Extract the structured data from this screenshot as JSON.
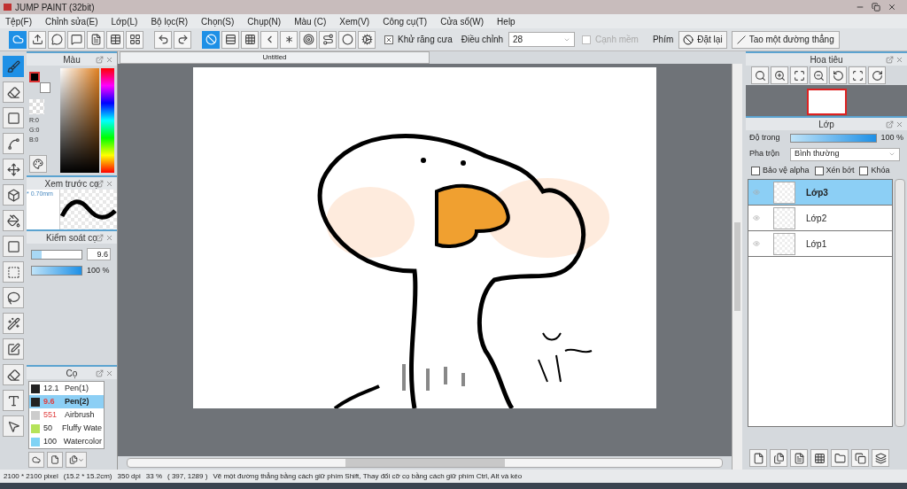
{
  "window": {
    "title": "JUMP PAINT (32bit)"
  },
  "menu": [
    "Tệp(F)",
    "Chỉnh sửa(E)",
    "Lớp(L)",
    "Bộ lọc(R)",
    "Chọn(S)",
    "Chụp(N)",
    "Màu (C)",
    "Xem(V)",
    "Công cụ(T)",
    "Cửa sổ(W)",
    "Help"
  ],
  "toolbar": {
    "rulers": [
      {
        "selected": true
      },
      {
        "selected": false
      },
      {
        "selected": false
      },
      {
        "selected": false
      },
      {
        "selected": false
      },
      {
        "selected": false
      },
      {
        "selected": false
      },
      {
        "selected": false
      },
      {
        "selected": false
      }
    ],
    "antialias": {
      "label": "Khử răng cưa",
      "checked": true
    },
    "adjust": {
      "label": "Điều chỉnh",
      "value": "28"
    },
    "soft_edge": {
      "label": "Cạnh mềm",
      "checked": false,
      "disabled": true
    },
    "keys_label": "Phím",
    "reset_button": "Đặt lại",
    "line_button": "Tao một đường thẳng"
  },
  "tools": [
    {
      "selected": true
    },
    {
      "selected": false
    },
    {
      "selected": false
    },
    {
      "selected": false
    },
    {
      "selected": false
    },
    {
      "selected": false
    },
    {
      "selected": false
    },
    {
      "selected": false
    },
    {
      "selected": false
    },
    {
      "selected": false
    },
    {
      "selected": false
    },
    {
      "selected": false
    },
    {
      "selected": false
    },
    {
      "selected": false
    },
    {
      "selected": false
    }
  ],
  "color_panel": {
    "title": "Màu",
    "rgb": [
      "R:0",
      "G:0",
      "B:0"
    ]
  },
  "brush_preview": {
    "title": "Xem trước cọ",
    "size": "* 0.70mm"
  },
  "brush_control": {
    "title": "Kiểm soát cọ",
    "size": {
      "level": 0.2,
      "reading": "9.6"
    },
    "opacity": {
      "level": 1,
      "reading": "100 %"
    }
  },
  "brushes": {
    "title": "Cọ",
    "items": [
      {
        "size": "12.1",
        "name": "Pen(1)",
        "color": "#222222",
        "flagged": false,
        "selected": false
      },
      {
        "size": "9.6",
        "name": "Pen(2)",
        "color": "#222222",
        "flagged": true,
        "selected": true
      },
      {
        "size": "551",
        "name": "Airbrush",
        "color": "#cccccc",
        "flagged": true,
        "selected": false
      },
      {
        "size": "50",
        "name": "Fluffy Wate",
        "color": "#b5e35a",
        "flagged": false,
        "selected": false
      },
      {
        "size": "100",
        "name": "Watercolor",
        "color": "#7fd3f5",
        "flagged": false,
        "selected": false
      }
    ]
  },
  "document": {
    "tab": "Untitled"
  },
  "navigator": {
    "title": "Hoa tiêu"
  },
  "layers": {
    "title": "Lớp",
    "opacity_label": "Độ trong",
    "opacity": {
      "level": 1,
      "reading": "100 %"
    },
    "blend_label": "Pha trộn",
    "blend_value": "Bình thường",
    "options": [
      {
        "label": "Bảo vệ alpha",
        "checked": false
      },
      {
        "label": "Xén bớt",
        "checked": false
      },
      {
        "label": "Khóa",
        "checked": false
      }
    ],
    "items": [
      {
        "name": "Lớp3",
        "selected": true
      },
      {
        "name": "Lớp2",
        "selected": false
      },
      {
        "name": "Lớp1",
        "selected": false
      }
    ]
  },
  "status_bar": [
    "2100 * 2100 pixel",
    "(15.2 * 15.2cm)",
    "350 dpi",
    "33 %",
    "( 397, 1289 )",
    "Vẽ một đường thẳng bằng cách giữ phím Shift, Thay đổi cỡ cọ bằng cách giữ phím Ctrl, Alt và kéo"
  ]
}
